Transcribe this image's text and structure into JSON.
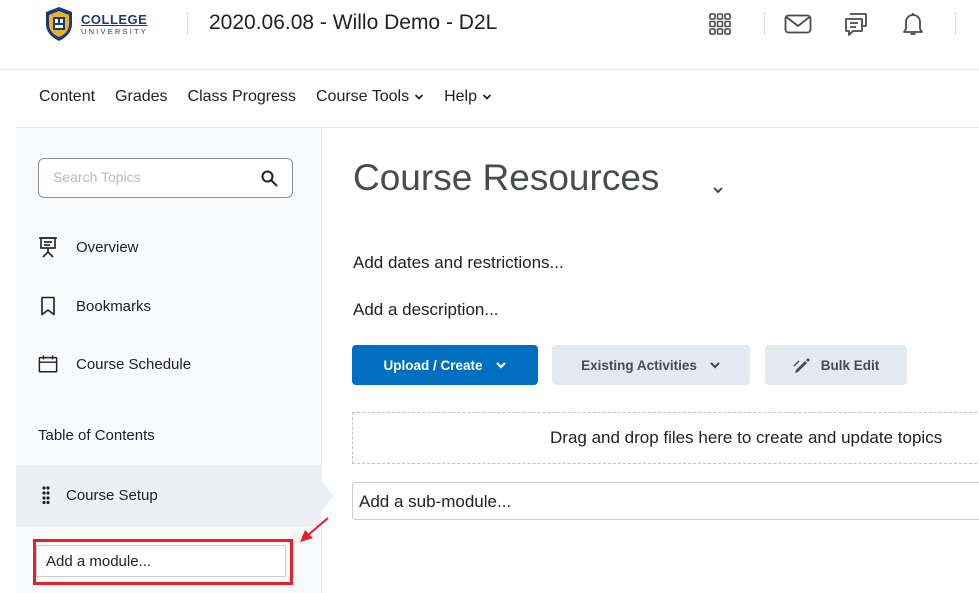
{
  "header": {
    "logo_main": "COLLEGE",
    "logo_sub": "UNIVERSITY",
    "course_title": "2020.06.08 - Willo Demo - D2L",
    "icons": [
      "waffle-icon",
      "mail-icon",
      "chat-icon",
      "bell-icon"
    ]
  },
  "nav": {
    "items": [
      {
        "label": "Content",
        "dropdown": false
      },
      {
        "label": "Grades",
        "dropdown": false
      },
      {
        "label": "Class Progress",
        "dropdown": false
      },
      {
        "label": "Course Tools",
        "dropdown": true
      },
      {
        "label": "Help",
        "dropdown": true
      }
    ]
  },
  "sidebar": {
    "search_placeholder": "Search Topics",
    "items": [
      {
        "label": "Overview",
        "icon": "presentation-icon"
      },
      {
        "label": "Bookmarks",
        "icon": "bookmark-icon"
      },
      {
        "label": "Course Schedule",
        "icon": "calendar-icon"
      }
    ],
    "toc_label": "Table of Contents",
    "module_label": "Course Setup",
    "add_module": "Add a module..."
  },
  "main": {
    "title": "Course Resources",
    "add_dates": "Add dates and restrictions...",
    "add_description": "Add a description...",
    "upload_create": "Upload / Create",
    "existing_activities": "Existing Activities",
    "bulk_edit": "Bulk Edit",
    "dropzone_text": "Drag and drop files here to create and update topics",
    "add_submodule": "Add a sub-module..."
  },
  "colors": {
    "primary": "#006fbf",
    "secondary_bg": "#e3e9f1",
    "highlight": "#e5202a",
    "brand": "#1b3a7a"
  }
}
